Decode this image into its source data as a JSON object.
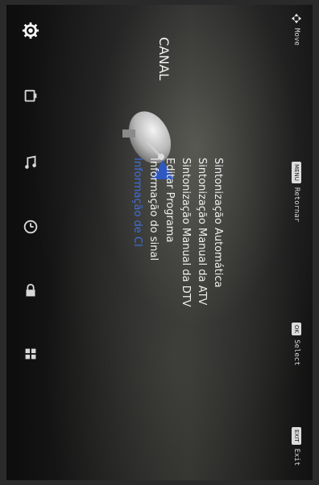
{
  "menu": {
    "category": "CANAL",
    "items": [
      {
        "label": "Sintonização Automática",
        "enabled": true
      },
      {
        "label": "Sintonização Manual da ATV",
        "enabled": true
      },
      {
        "label": "Sintonização Manual da DTV",
        "enabled": true
      },
      {
        "label": "Editar Programa",
        "enabled": true
      },
      {
        "label": "Informação do sinal",
        "enabled": true
      },
      {
        "label": "Informação de CI",
        "enabled": false
      }
    ]
  },
  "tabs": [
    {
      "icon": "gear-icon",
      "active": true
    },
    {
      "icon": "picture-icon"
    },
    {
      "icon": "music-icon"
    },
    {
      "icon": "clock-icon"
    },
    {
      "icon": "lock-icon"
    },
    {
      "icon": "grid-icon"
    }
  ],
  "hints": {
    "move": "Move",
    "menu_key": "MENU",
    "menu_label": "Retornar",
    "ok_key": "OK",
    "ok_label": "Select",
    "exit_key": "EXIT",
    "exit_label": "Exit"
  },
  "colors": {
    "menu_text": "#efefef",
    "disabled_text": "#3f6fd8",
    "dish_beam": "#2a5bd6"
  }
}
